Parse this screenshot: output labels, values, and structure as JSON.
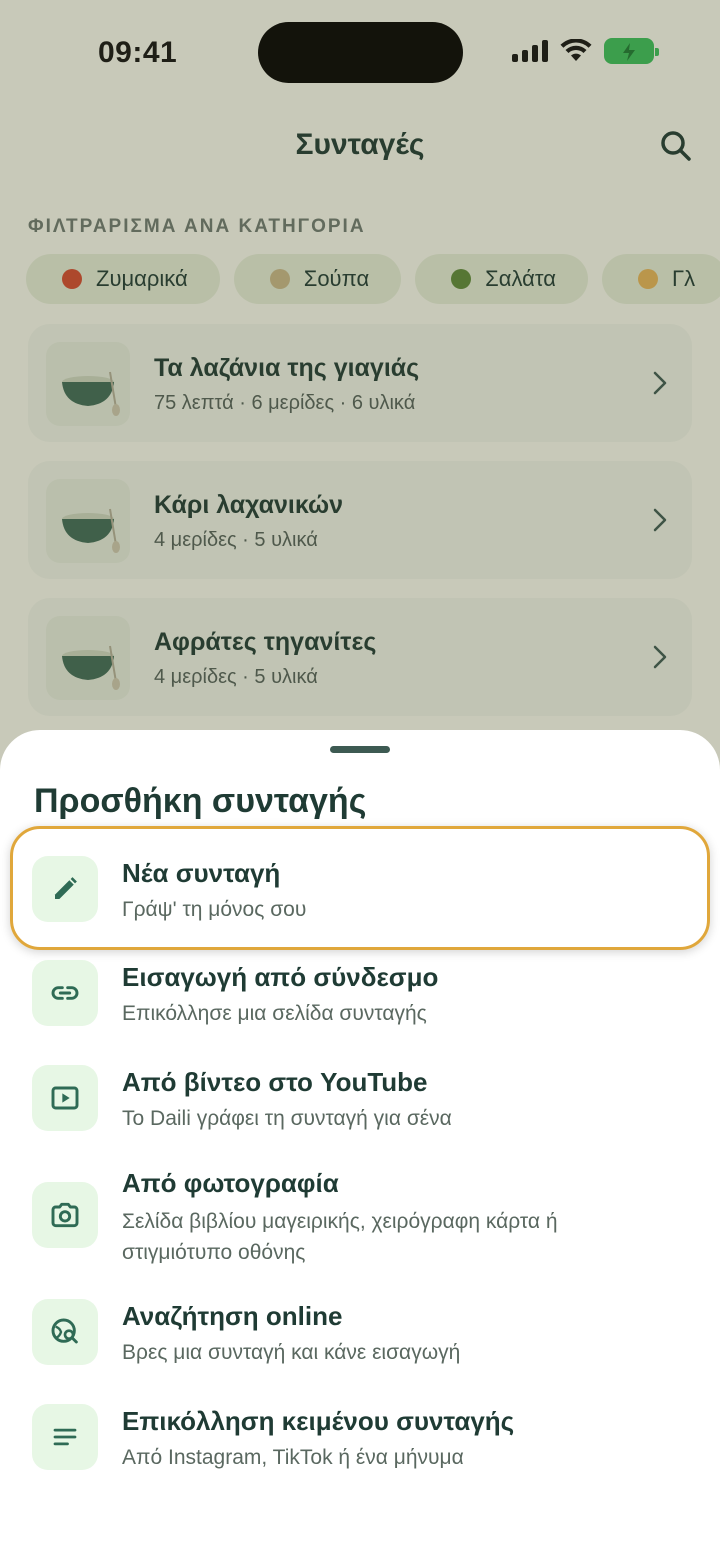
{
  "status": {
    "time": "09:41"
  },
  "nav": {
    "title": "Συνταγές"
  },
  "filters": {
    "label": "ΦΙΛΤΡΑΡΙΣΜΑ ΑΝΑ ΚΑΤΗΓΟΡΙΑ",
    "chips": [
      {
        "label": "Ζυμαρικά",
        "color": "#d64a2f"
      },
      {
        "label": "Σούπα",
        "color": "#c9b98a"
      },
      {
        "label": "Σαλάτα",
        "color": "#5e8a3a"
      },
      {
        "label": "Γλ",
        "color": "#e8b659"
      }
    ]
  },
  "recipes": [
    {
      "title": "Τα λαζάνια της γιαγιάς",
      "meta": "75 λεπτά · 6 μερίδες · 6 υλικά"
    },
    {
      "title": "Κάρι λαχανικών",
      "meta": "4 μερίδες · 5 υλικά"
    },
    {
      "title": "Αφράτες τηγανίτες",
      "meta": "4 μερίδες · 5 υλικά"
    }
  ],
  "sheet": {
    "title": "Προσθήκη συνταγής",
    "options": [
      {
        "icon": "pencil-icon",
        "title": "Νέα συνταγή",
        "subtitle": "Γράψ' τη μόνος σου"
      },
      {
        "icon": "link-icon",
        "title": "Εισαγωγή από σύνδεσμο",
        "subtitle": "Επικόλλησε μια σελίδα συνταγής"
      },
      {
        "icon": "video-icon",
        "title": "Από βίντεο στο YouTube",
        "subtitle": "Το Daili γράφει τη συνταγή για σένα"
      },
      {
        "icon": "camera-icon",
        "title": "Από φωτογραφία",
        "subtitle": "Σελίδα βιβλίου μαγειρικής, χειρόγραφη κάρτα ή στιγμιότυπο οθόνης"
      },
      {
        "icon": "globe-search-icon",
        "title": "Αναζήτηση online",
        "subtitle": "Βρες μια συνταγή και κάνε εισαγωγή"
      },
      {
        "icon": "text-lines-icon",
        "title": "Επικόλληση κειμένου συνταγής",
        "subtitle": "Από Instagram, TikTok ή ένα μήνυμα"
      }
    ]
  },
  "colors": {
    "accent": "#2f6b55",
    "highlight": "#e0a73b",
    "icon_bg": "#e7f7e5"
  }
}
